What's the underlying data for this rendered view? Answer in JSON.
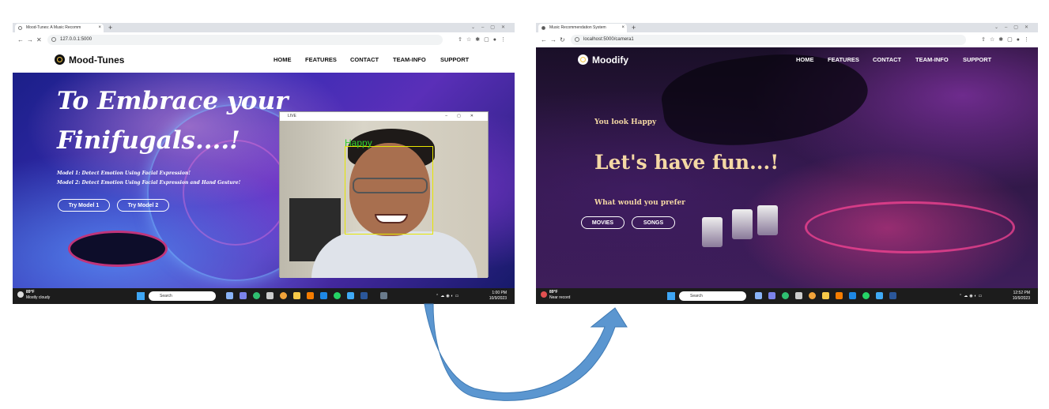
{
  "left": {
    "tab_title": "Mood-Tunes: A Music Recomm",
    "tab_close": "×",
    "new_tab": "+",
    "url": "127.0.0.1:5000",
    "brand": "Mood-Tunes",
    "menu": [
      "HOME",
      "FEATURES",
      "CONTACT",
      "TEAM-INFO",
      "SUPPORT"
    ],
    "tagline_1": "To Embrace your",
    "tagline_2": "Finifugals....!",
    "model_1": "Model 1: Detect Emotion Using Facial Expression!",
    "model_2": "Model 2: Detect Emotion Using Facial Expression and Hand Gesture!",
    "btn_model1": "Try Model 1",
    "btn_model2": "Try Model 2",
    "live_title": "LIVE",
    "emotion": "Happy",
    "weather_temp": "89°F",
    "weather_desc": "Mostly cloudy",
    "search": "Search",
    "time": "1:00 PM",
    "date": "10/9/2023"
  },
  "right": {
    "tab_title": "Music Recommendation System",
    "tab_close": "×",
    "new_tab": "+",
    "url": "localhost:5000/camera1",
    "brand": "Moodify",
    "menu": [
      "HOME",
      "FEATURES",
      "CONTACT",
      "TEAM-INFO",
      "SUPPORT"
    ],
    "look": "You look Happy",
    "headline": "Let's have fun...!",
    "prefer": "What would you prefer",
    "btn_movies": "MOVIES",
    "btn_songs": "SONGS",
    "weather_temp": "89°F",
    "weather_desc": "Near record",
    "search": "Search",
    "time": "12:52 PM",
    "date": "10/9/2023"
  },
  "colors": {
    "arrow": "#5b96d0",
    "face_box": "#e6e600",
    "emotion_text": "#2fd02f",
    "moodify_text": "#f4d8a4"
  }
}
